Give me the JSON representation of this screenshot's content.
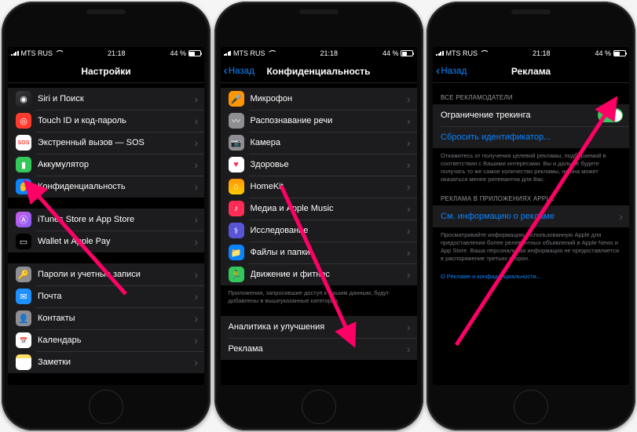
{
  "status": {
    "carrier": "MTS RUS",
    "time": "21:18",
    "battery_pct": "44 %"
  },
  "phone1": {
    "title": "Настройки",
    "groups": [
      {
        "id": "g1",
        "items": [
          {
            "icon": "siri",
            "label": "Siri и Поиск"
          },
          {
            "icon": "touchid",
            "label": "Touch ID и код-пароль"
          },
          {
            "icon": "sos",
            "label": "Экстренный вызов — SOS"
          },
          {
            "icon": "battery",
            "label": "Аккумулятор"
          },
          {
            "icon": "privacy",
            "label": "Конфиденциальность"
          }
        ]
      },
      {
        "id": "g2",
        "items": [
          {
            "icon": "itunes",
            "label": "iTunes Store и App Store"
          },
          {
            "icon": "wallet",
            "label": "Wallet и Apple Pay"
          }
        ]
      },
      {
        "id": "g3",
        "items": [
          {
            "icon": "passwords",
            "label": "Пароли и учетные записи"
          },
          {
            "icon": "mail",
            "label": "Почта"
          },
          {
            "icon": "contacts",
            "label": "Контакты"
          },
          {
            "icon": "calendar",
            "label": "Календарь"
          },
          {
            "icon": "notes",
            "label": "Заметки"
          }
        ]
      }
    ]
  },
  "phone2": {
    "back": "Назад",
    "title": "Конфиденциальность",
    "groups": [
      {
        "id": "g1",
        "items": [
          {
            "icon": "mic",
            "label": "Микрофон"
          },
          {
            "icon": "speech",
            "label": "Распознавание речи"
          },
          {
            "icon": "camera",
            "label": "Камера"
          },
          {
            "icon": "health",
            "label": "Здоровье"
          },
          {
            "icon": "homekit",
            "label": "HomeKit"
          },
          {
            "icon": "media",
            "label": "Медиа и Apple Music"
          },
          {
            "icon": "research",
            "label": "Исследование"
          },
          {
            "icon": "files",
            "label": "Файлы и папки"
          },
          {
            "icon": "motion",
            "label": "Движение и фитнес"
          }
        ]
      },
      {
        "id": "g2",
        "footer": "Приложения, запросившие доступ к Вашим данным, будут добавлены в вышеуказанные категории.",
        "items": []
      },
      {
        "id": "g3",
        "items": [
          {
            "label": "Аналитика и улучшения",
            "noicon": true
          },
          {
            "label": "Реклама",
            "noicon": true
          }
        ]
      }
    ]
  },
  "phone3": {
    "back": "Назад",
    "title": "Реклама",
    "sections": [
      {
        "header": "ВСЕ РЕКЛАМОДАТЕЛИ",
        "items": [
          {
            "type": "switch",
            "label": "Ограничение трекинга",
            "on": true
          },
          {
            "type": "link",
            "label": "Сбросить идентификатор..."
          }
        ],
        "footer": "Откажитесь от получения целевой рекламы, подбираемой в соответствии с Вашими интересами. Вы и дальше будете получать то же самое количество рекламы, но она может оказаться менее релевантна для Вас."
      },
      {
        "header": "РЕКЛАМА В ПРИЛОЖЕНИЯХ APPLE",
        "items": [
          {
            "type": "link",
            "label": "См. информацию о рекламе"
          }
        ],
        "footer": "Просматривайте информацию, использованную Apple для предоставления более релевантных объявлений в Apple News и App Store. Ваша персональная информация не предоставляется в распоряжение третьих сторон."
      }
    ],
    "bottom_link": "О Рекламе и конфиденциальности..."
  }
}
